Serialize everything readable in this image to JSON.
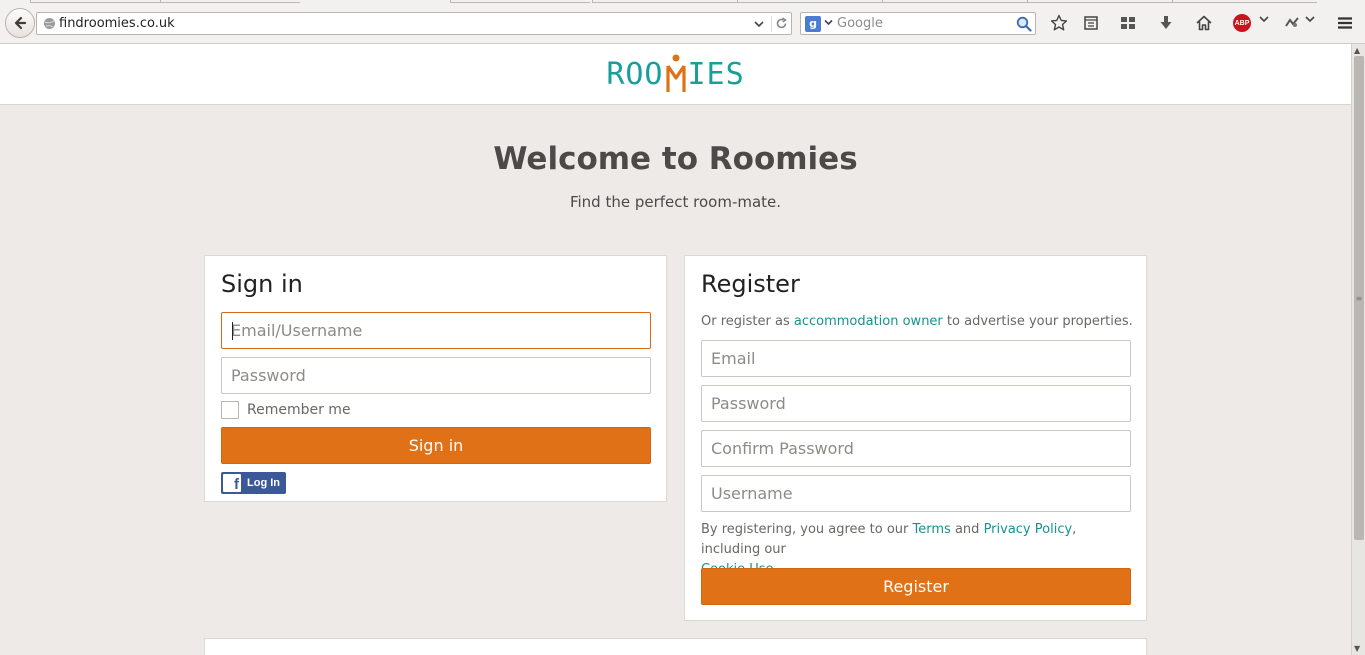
{
  "browser": {
    "url": "findroomies.co.uk",
    "search_placeholder": "Google",
    "search_engine_letter": "g",
    "adblock_label": "ABP"
  },
  "site": {
    "logo_left": "ROO",
    "logo_right": "IES",
    "logo_color": "#199f9a",
    "logo_accent": "#e07117"
  },
  "hero": {
    "title": "Welcome to Roomies",
    "subtitle": "Find the perfect room-mate."
  },
  "signin": {
    "heading": "Sign in",
    "email_placeholder": "Email/Username",
    "password_placeholder": "Password",
    "remember_label": "Remember me",
    "button_label": "Sign in",
    "facebook_label": "Log In"
  },
  "register": {
    "heading": "Register",
    "intro_before": "Or register as ",
    "intro_link": "accommodation owner",
    "intro_after": " to advertise your properties.",
    "email_placeholder": "Email",
    "password_placeholder": "Password",
    "confirm_placeholder": "Confirm Password",
    "username_placeholder": "Username",
    "terms_before": "By registering, you agree to our ",
    "terms_link": "Terms",
    "terms_and": " and ",
    "privacy_link": "Privacy Policy",
    "terms_including": ", including our",
    "cookie_link": "Cookie Use",
    "terms_end": ".",
    "button_label": "Register"
  },
  "colors": {
    "accent": "#e07117",
    "link": "#16938e",
    "page_bg": "#edeae7"
  }
}
